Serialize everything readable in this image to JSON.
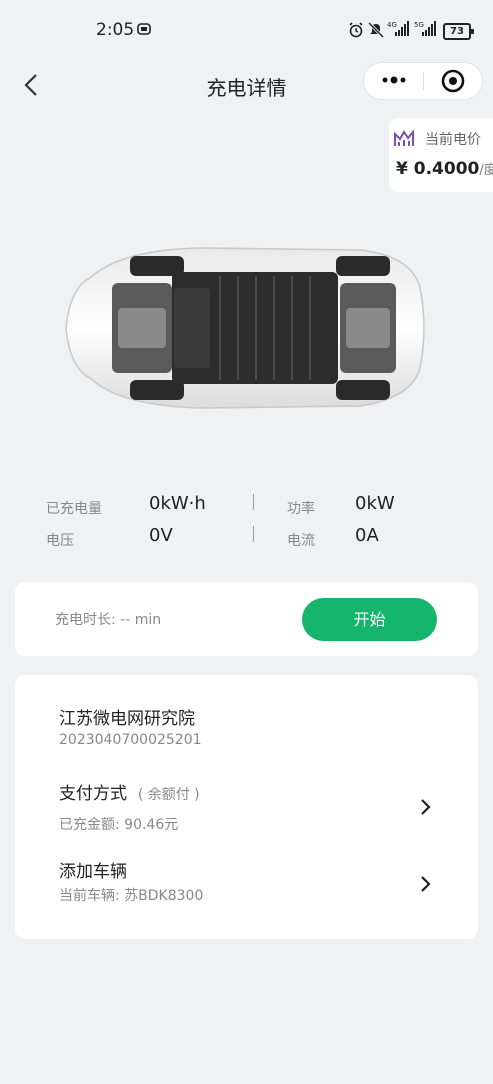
{
  "status_bar": {
    "time": "2:05",
    "battery": "73"
  },
  "nav": {
    "title": "充电详情"
  },
  "price": {
    "label": "当前电价",
    "value": "¥ 0.4000",
    "unit": "/度"
  },
  "stats": {
    "charged_label": "已充电量",
    "charged_value": "0kW·h",
    "power_label": "功率",
    "power_value": "0kW",
    "voltage_label": "电压",
    "voltage_value": "0V",
    "current_label": "电流",
    "current_value": "0A"
  },
  "duration": {
    "label": "充电时长:  -- min",
    "button": "开始"
  },
  "station": {
    "name": "江苏微电网研究院",
    "id": "2023040700025201"
  },
  "payment": {
    "title": "支付方式",
    "note": "( 余额付 )",
    "sub": "已充金额:  90.46元"
  },
  "vehicle": {
    "title": "添加车辆",
    "sub": "当前车辆:  苏BDK8300"
  },
  "colors": {
    "accent": "#15b66c",
    "price_icon": "#7b4fb0"
  }
}
